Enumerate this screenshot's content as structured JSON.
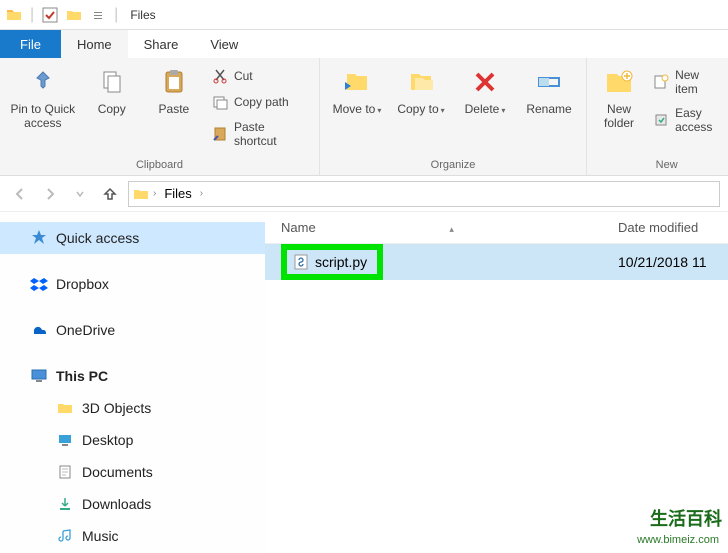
{
  "title_bar": {
    "window_title": "Files"
  },
  "tabs": {
    "file": "File",
    "home": "Home",
    "share": "Share",
    "view": "View"
  },
  "ribbon": {
    "clipboard": {
      "label": "Clipboard",
      "pin": "Pin to Quick access",
      "copy": "Copy",
      "paste": "Paste",
      "cut": "Cut",
      "copy_path": "Copy path",
      "paste_shortcut": "Paste shortcut"
    },
    "organize": {
      "label": "Organize",
      "move_to": "Move to",
      "copy_to": "Copy to",
      "delete": "Delete",
      "rename": "Rename"
    },
    "new": {
      "label": "New",
      "new_folder": "New folder",
      "new_item": "New item",
      "easy_access": "Easy access"
    }
  },
  "breadcrumb": {
    "current": "Files"
  },
  "columns": {
    "name": "Name",
    "date": "Date modified"
  },
  "sidebar": {
    "quick_access": "Quick access",
    "dropbox": "Dropbox",
    "onedrive": "OneDrive",
    "this_pc": "This PC",
    "objects3d": "3D Objects",
    "desktop": "Desktop",
    "documents": "Documents",
    "downloads": "Downloads",
    "music": "Music"
  },
  "file": {
    "name": "script.py",
    "date": "10/21/2018 11"
  },
  "watermark": {
    "cn": "生活百科",
    "url": "www.bimeiz.com"
  }
}
